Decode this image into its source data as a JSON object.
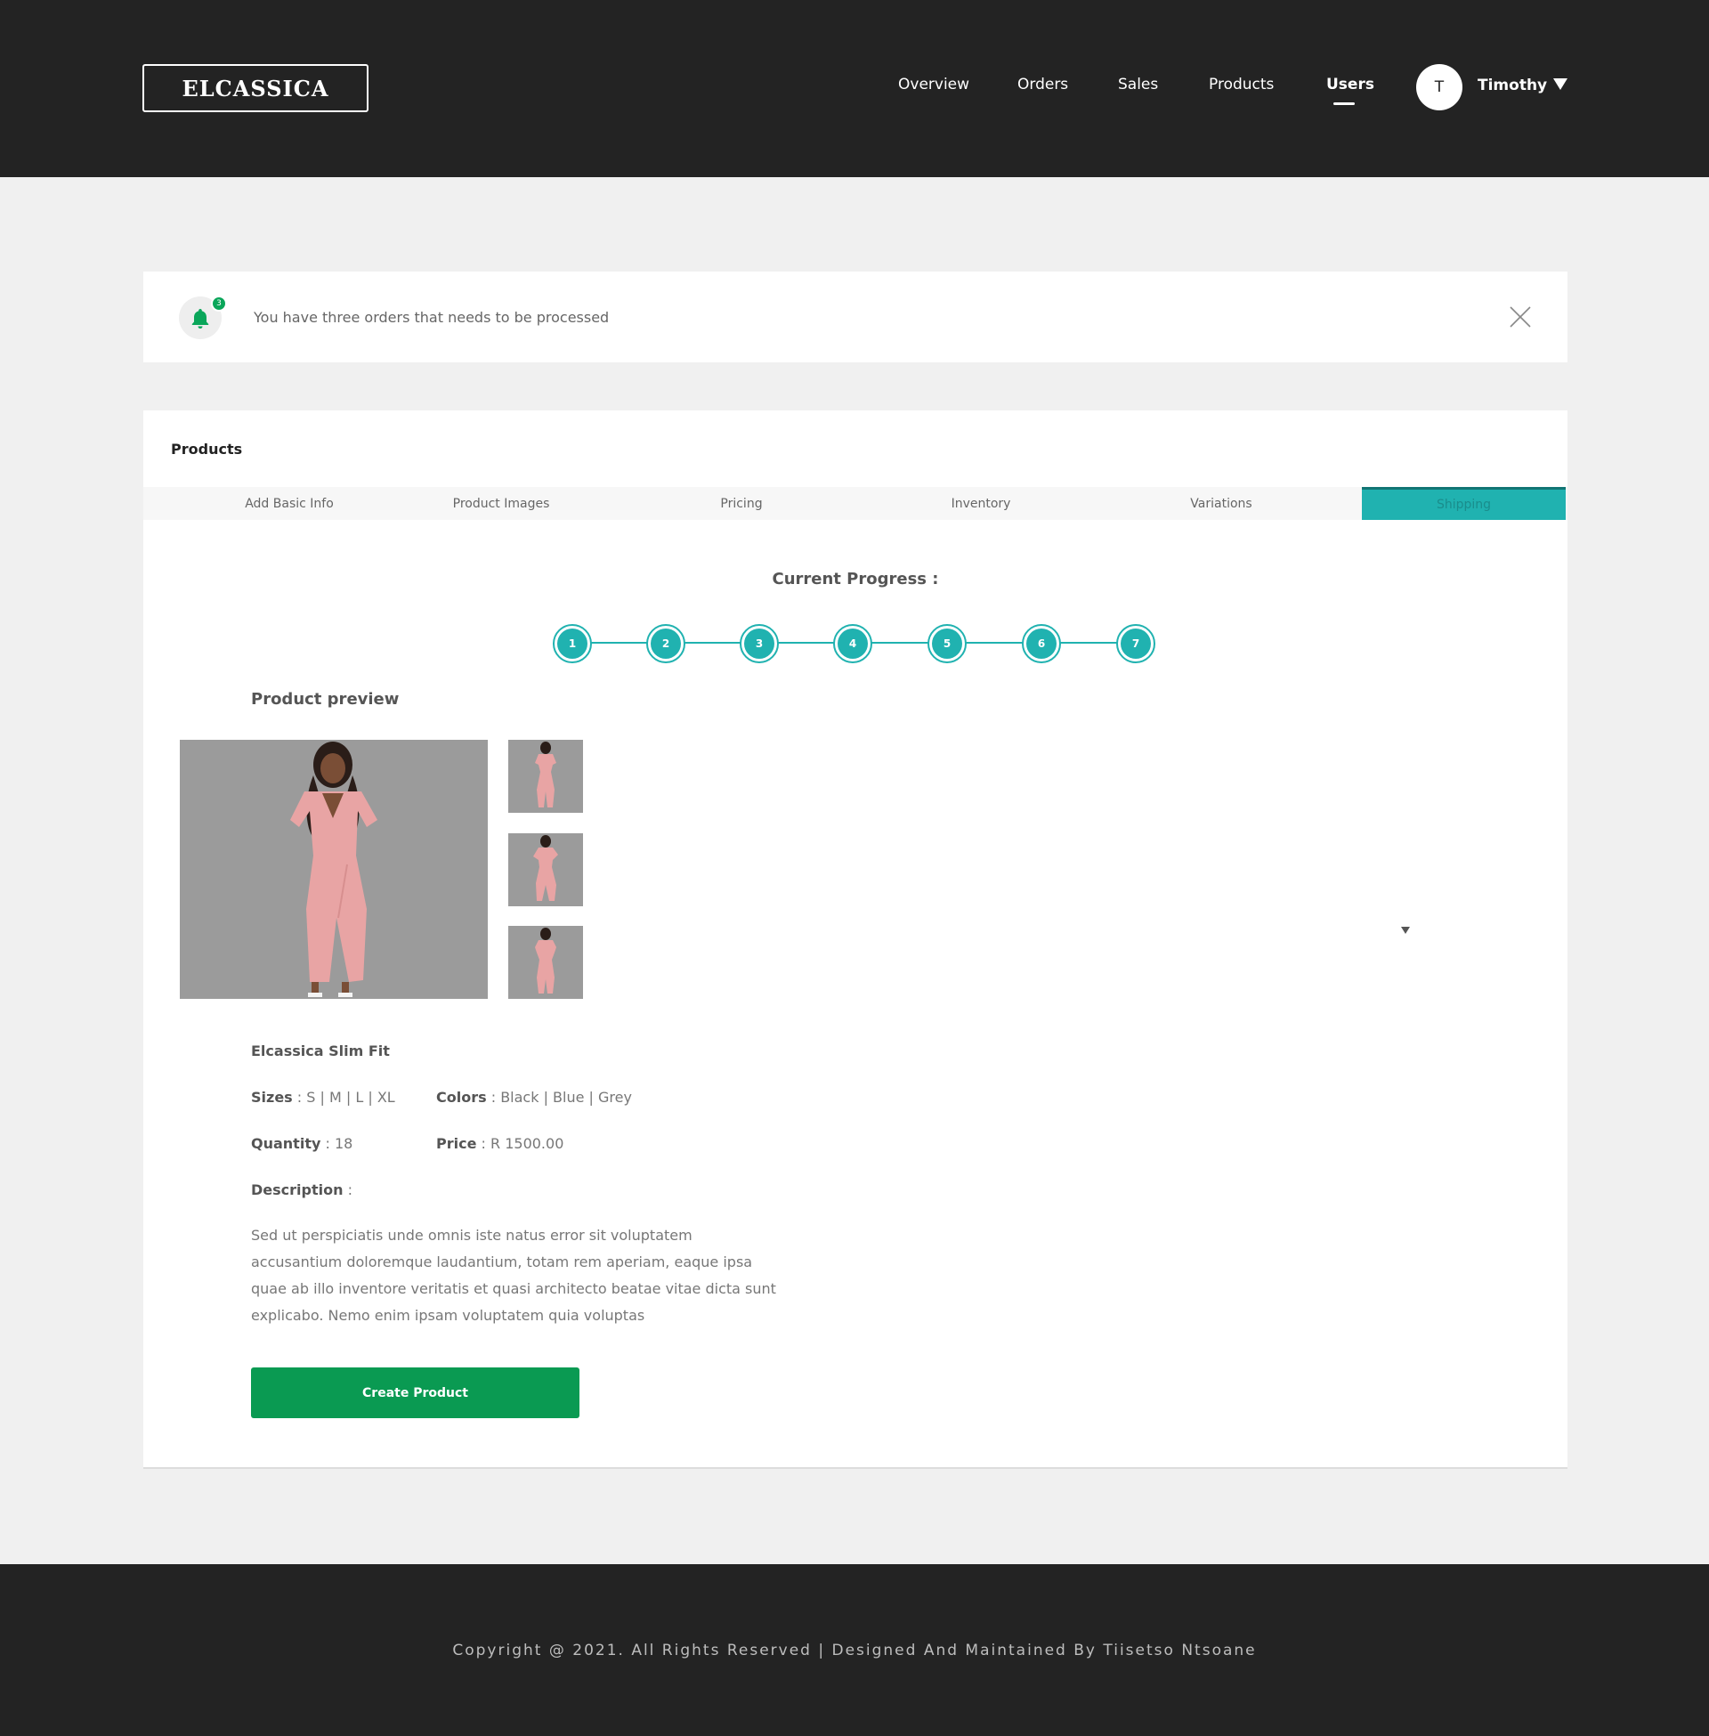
{
  "header": {
    "logo": "ELCASSICA",
    "nav": [
      {
        "label": "Overview"
      },
      {
        "label": "Orders"
      },
      {
        "label": "Sales"
      },
      {
        "label": "Products"
      },
      {
        "label": "Users",
        "active": true
      }
    ],
    "user": {
      "initial": "T",
      "name": "Timothy"
    }
  },
  "alert": {
    "icon": "bell-icon",
    "badge": "3",
    "message": "You have three orders that needs to be processed",
    "close_icon": "close-icon"
  },
  "products_card": {
    "title": "Products",
    "tabs": [
      {
        "label": "Add Basic Info"
      },
      {
        "label": "Product Images"
      },
      {
        "label": "Pricing"
      },
      {
        "label": "Inventory"
      },
      {
        "label": "Variations"
      },
      {
        "label": "Shipping",
        "active": true
      }
    ],
    "progress": {
      "title": "Current Progress :",
      "steps": [
        "1",
        "2",
        "3",
        "4",
        "5",
        "6",
        "7"
      ],
      "completed": 7
    },
    "preview": {
      "title": "Product preview",
      "name": "Elcassica Slim Fit",
      "sizes_label": "Sizes",
      "sizes_value": " : S | M | L | XL",
      "colors_label": "Colors",
      "colors_value": " : Black | Blue | Grey",
      "quantity_label": "Quantity",
      "quantity_value": " : 18",
      "price_label": "Price",
      "price_value": " : R 1500.00",
      "description_label": "Description",
      "description_suffix": " :",
      "description": "Sed ut perspiciatis unde omnis iste natus error sit voluptatem accusantium doloremque laudantium, totam rem aperiam, eaque ipsa quae ab illo inventore veritatis et quasi architecto beatae vitae dicta sunt explicabo. Nemo enim ipsam voluptatem quia voluptas"
    },
    "create_button": "Create Product"
  },
  "footer": {
    "text": "Copyright @ 2021. All Rights Reserved | Designed And Maintained By Tiisetso Ntsoane"
  },
  "colors": {
    "header_bg": "#232323",
    "accent_teal": "#20b2b0",
    "accent_green": "#0a9a52",
    "page_bg": "#f0f0f0"
  }
}
